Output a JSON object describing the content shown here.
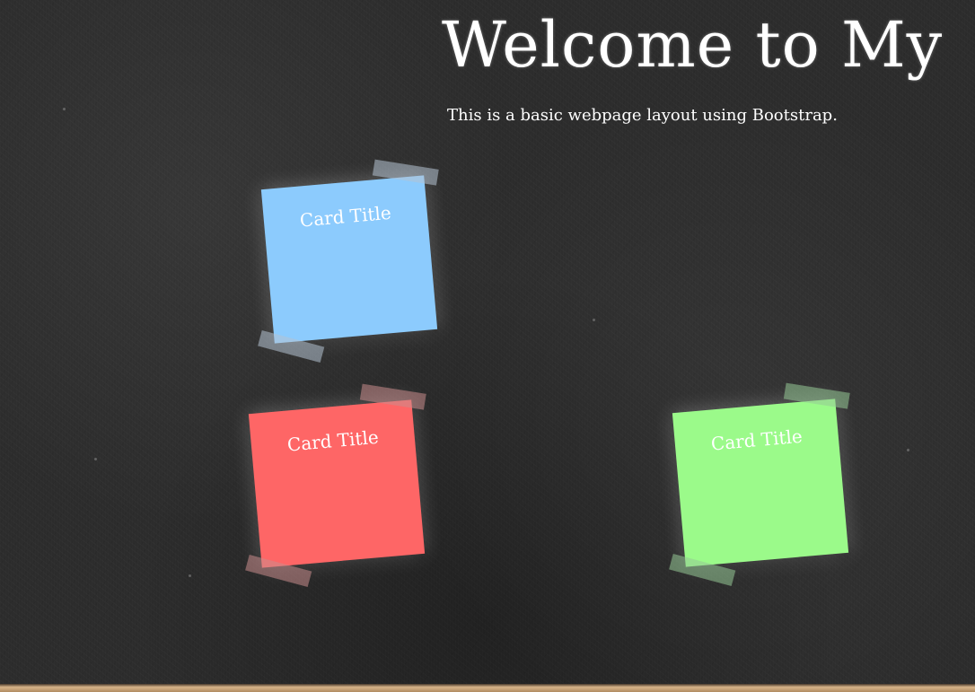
{
  "header": {
    "title": "Welcome to My",
    "subtitle": "This is a basic webpage layout using Bootstrap."
  },
  "cards": [
    {
      "title": "Card Title",
      "color": "#8ccbfd"
    },
    {
      "title": "Card Title",
      "color": "#fe6666"
    },
    {
      "title": "Card Title",
      "color": "#9bfa8a"
    }
  ],
  "colors": {
    "background": "#2c2c2c",
    "text": "#ffffff",
    "frame": "#d7b48a"
  }
}
